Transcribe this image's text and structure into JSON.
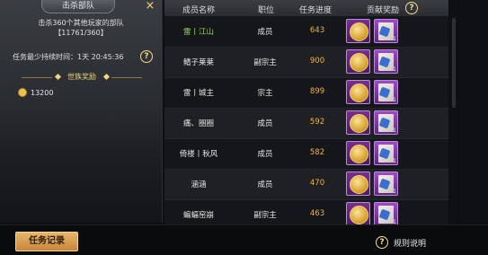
{
  "mission": {
    "tab_label": "击杀部队",
    "close_label": "×",
    "description_line1": "击杀360个其他玩家的部队",
    "description_line2": "【11761/360】",
    "min_duration": "任务最少持续时间：1天 20:45:36",
    "reward_section_title": "世族奖励",
    "reward_amount": "13200"
  },
  "table": {
    "headers": {
      "name": "成员名称",
      "position": "职位",
      "progress": "任务进度",
      "reward": "贡献奖励"
    },
    "rows": [
      {
        "name": "雷丨江山",
        "position": "成员",
        "progress": "643",
        "scroll_qty": "1"
      },
      {
        "name": "鳍子莱莱",
        "position": "副宗主",
        "progress": "900",
        "scroll_qty": "1"
      },
      {
        "name": "雷丨城主",
        "position": "宗主",
        "progress": "899",
        "scroll_qty": "1"
      },
      {
        "name": "痛、圈圈",
        "position": "成员",
        "progress": "592",
        "scroll_qty": "1"
      },
      {
        "name": "倚楼丨秋风",
        "position": "成员",
        "progress": "582",
        "scroll_qty": "1"
      },
      {
        "name": "涵涵",
        "position": "成员",
        "progress": "470",
        "scroll_qty": "1"
      },
      {
        "name": "蝙蝠窑崩",
        "position": "副宗主",
        "progress": "463",
        "scroll_qty": "1"
      }
    ]
  },
  "bottom": {
    "record_button": "任务记录",
    "rules_label": "规则说明",
    "help_glyph": "?"
  },
  "colors": {
    "progress": "#f0b440",
    "gold_accent": "#f0d67a",
    "highlight_name": "#9fd36a"
  }
}
